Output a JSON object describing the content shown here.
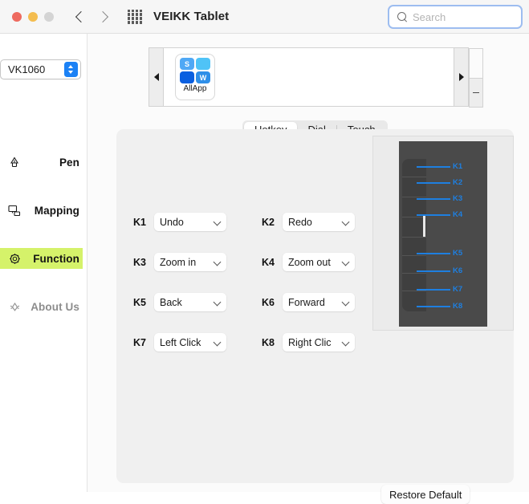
{
  "window": {
    "title": "VEIKK Tablet",
    "traffic_lights": [
      "close",
      "minimize",
      "zoom"
    ],
    "back_icon": "chevron-left-icon",
    "forward_icon": "chevron-right-icon",
    "grid_icon": "app-grid-icon"
  },
  "search": {
    "placeholder": "Search",
    "value": "",
    "icon": "search-icon",
    "focus_ring_color": "#9dbdf0"
  },
  "sidebar": {
    "device": {
      "value": "VK1060",
      "stepper_icon": "up-down-stepper-icon",
      "accent": "#1b81f5"
    },
    "items": [
      {
        "id": "pen",
        "label": "Pen",
        "icon": "pen-icon",
        "active": false
      },
      {
        "id": "mapping",
        "label": "Mapping",
        "icon": "monitor-icon",
        "active": false
      },
      {
        "id": "function",
        "label": "Function",
        "icon": "gear-icon",
        "active": true
      },
      {
        "id": "about",
        "label": "About Us",
        "icon": "info-icon",
        "active": false
      }
    ],
    "active_highlight_color": "#d5f26a"
  },
  "app_strip": {
    "prev_icon": "triangle-left-icon",
    "next_icon": "triangle-right-icon",
    "remove_icon": "minus-icon",
    "apps": [
      {
        "name": "AllApp",
        "icon": "allapp-grid-icon",
        "tiles": [
          {
            "letter": "S",
            "color": "#4fa8f5"
          },
          {
            "letter": "",
            "color": "#4fc3f7"
          },
          {
            "letter": "",
            "color": "#0a5fe0"
          },
          {
            "letter": "W",
            "color": "#2f8fe8"
          }
        ]
      }
    ]
  },
  "tabs": [
    {
      "label": "Hotkey",
      "selected": true
    },
    {
      "label": "Dial",
      "selected": false
    },
    {
      "label": "Touch",
      "selected": false
    }
  ],
  "hotkeys": [
    {
      "key": "K1",
      "value": "Undo"
    },
    {
      "key": "K2",
      "value": "Redo"
    },
    {
      "key": "K3",
      "value": "Zoom in"
    },
    {
      "key": "K4",
      "value": "Zoom out"
    },
    {
      "key": "K5",
      "value": "Back"
    },
    {
      "key": "K6",
      "value": "Forward"
    },
    {
      "key": "K7",
      "value": "Left Click"
    },
    {
      "key": "K8",
      "value": "Right Clic"
    }
  ],
  "preview": {
    "callout_color": "#1e7fe0",
    "tablet_color": "#4a4a4a",
    "callouts": [
      "K1",
      "K2",
      "K3",
      "K4",
      "K5",
      "K6",
      "K7",
      "K8"
    ]
  },
  "footer": {
    "restore_label": "Restore Default"
  }
}
